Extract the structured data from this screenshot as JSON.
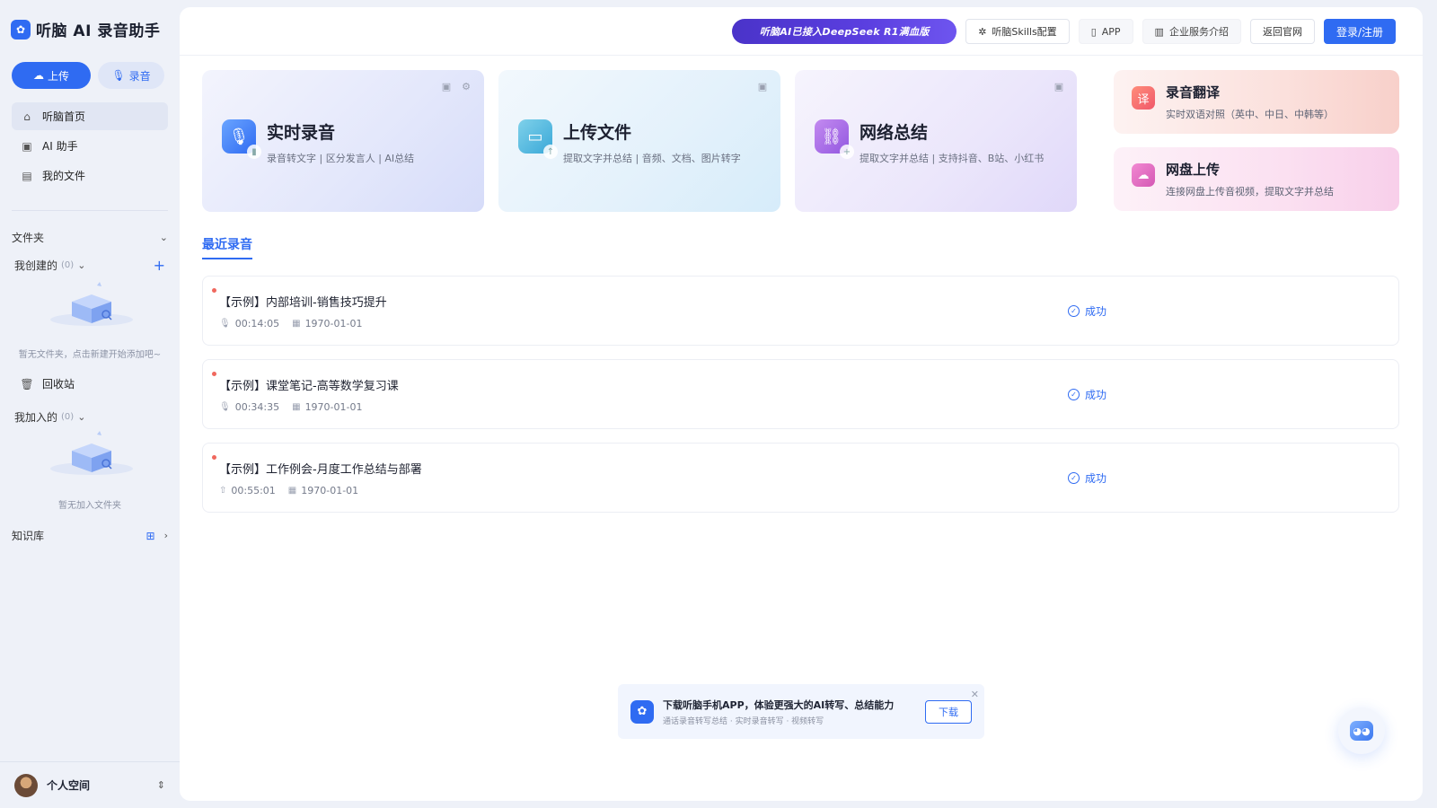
{
  "app": {
    "title": "听脑 AI 录音助手",
    "logo_glyph": "✿"
  },
  "sidebar": {
    "upload_label": "上传",
    "record_label": "录音",
    "nav": [
      {
        "label": "听脑首页",
        "icon": "home-icon",
        "glyph": "⌂"
      },
      {
        "label": "AI 助手",
        "icon": "assistant-icon",
        "glyph": "▣"
      },
      {
        "label": "我的文件",
        "icon": "file-icon",
        "glyph": "▤"
      }
    ],
    "folders_label": "文件夹",
    "created_label": "我创建的",
    "created_count": "(0)",
    "created_empty": "暂无文件夹，点击新建开始添加吧~",
    "trash_label": "回收站",
    "joined_label": "我加入的",
    "joined_count": "(0)",
    "joined_empty": "暂无加入文件夹",
    "kb_label": "知识库",
    "user_label": "个人空间"
  },
  "topbar": {
    "promo": "听脑AI已接入DeepSeek R1满血版",
    "skills": "听脑Skills配置",
    "app": "APP",
    "enterprise": "企业服务介绍",
    "home": "返回官网",
    "login": "登录/注册"
  },
  "cards": [
    {
      "title": "实时录音",
      "desc": "录音转文字 | 区分发言人 | AI总结",
      "icon": "microphone-icon"
    },
    {
      "title": "上传文件",
      "desc": "提取文字并总结 | 音频、文档、图片转字",
      "icon": "upload-folder-icon"
    },
    {
      "title": "网络总结",
      "desc": "提取文字并总结 | 支持抖音、B站、小红书",
      "icon": "link-icon"
    }
  ],
  "mini_cards": [
    {
      "title": "录音翻译",
      "desc": "实时双语对照（英中、中日、中韩等）",
      "icon": "translate-icon"
    },
    {
      "title": "网盘上传",
      "desc": "连接网盘上传音视频，提取文字并总结",
      "icon": "cloud-upload-icon"
    }
  ],
  "recent": {
    "title": "最近录音",
    "items": [
      {
        "title": "【示例】内部培训-销售技巧提升",
        "duration": "00:14:05",
        "date": "1970-01-01",
        "status": "成功",
        "source_icon": "microphone-icon"
      },
      {
        "title": "【示例】课堂笔记-高等数学复习课",
        "duration": "00:34:35",
        "date": "1970-01-01",
        "status": "成功",
        "source_icon": "microphone-icon"
      },
      {
        "title": "【示例】工作例会-月度工作总结与部署",
        "duration": "00:55:01",
        "date": "1970-01-01",
        "status": "成功",
        "source_icon": "upload-icon"
      }
    ]
  },
  "banner": {
    "title": "下载听脑手机APP，体验更强大的AI转写、总结能力",
    "sub": "通话录音转写总结 · 实时录音转写 · 视频转写",
    "button": "下载"
  },
  "colors": {
    "accent": "#2f6bf2",
    "danger_dot": "#f0685e"
  }
}
